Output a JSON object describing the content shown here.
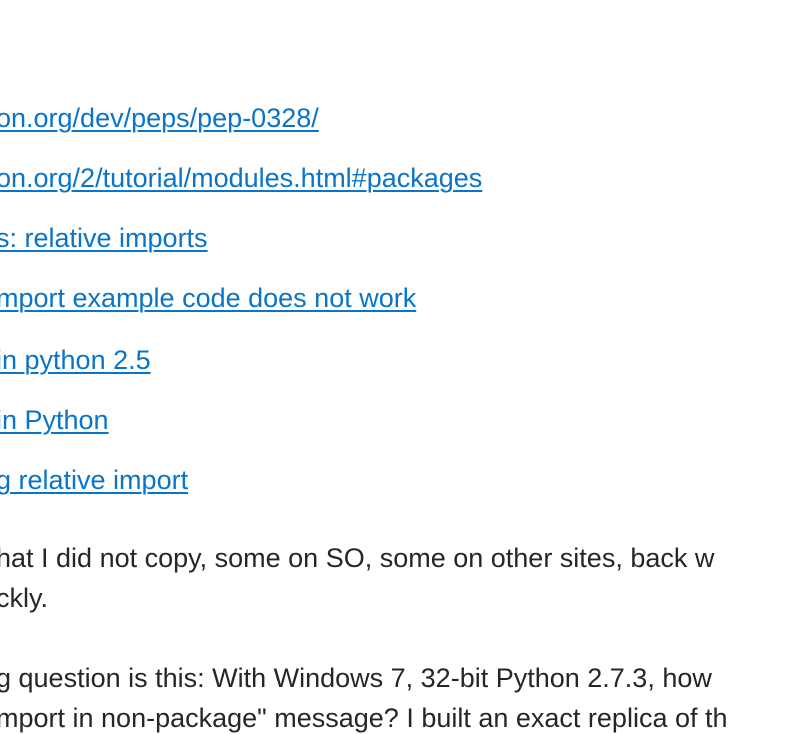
{
  "links": [
    {
      "text": "on.org/dev/peps/pep-0328/"
    },
    {
      "text": "on.org/2/tutorial/modules.html#packages"
    },
    {
      "text": "s: relative imports"
    },
    {
      "text": "mport example code does not work"
    },
    {
      "text": " in python 2.5"
    },
    {
      "text": " in Python"
    },
    {
      "text": "g relative import"
    }
  ],
  "paragraph1": {
    "line1": "hat I did not copy, some on SO, some on other sites, back w",
    "line2": "ckly."
  },
  "paragraph2": {
    "line1": "g question is this: With Windows 7, 32-bit Python 2.7.3, how",
    "line2": "mport in non-package\" message? I built an exact replica of th"
  },
  "colors": {
    "link": "#0a74c9",
    "text": "#242729",
    "background": "#ffffff"
  }
}
